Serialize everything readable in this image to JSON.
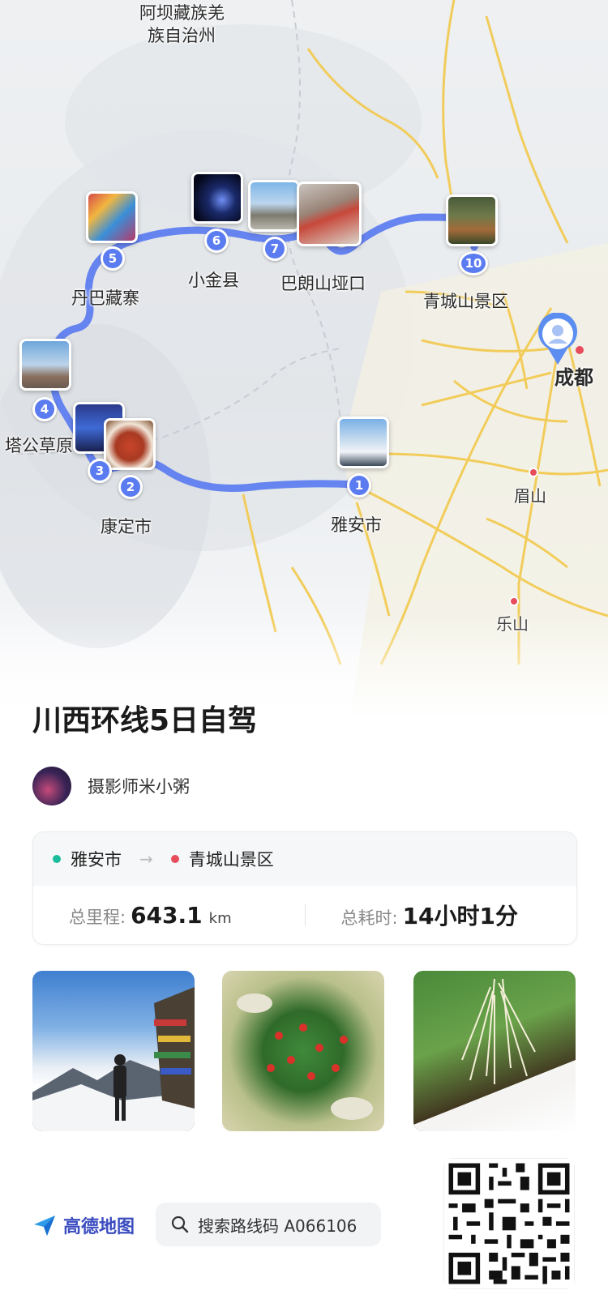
{
  "map": {
    "regions": {
      "aba": "阿坝藏族羌族自治州"
    },
    "places": {
      "aba_line1": "阿坝藏族羌",
      "aba_line2": "族自治州",
      "danba": "丹巴藏寨",
      "xiaojin": "小金县",
      "balang": "巴朗山垭口",
      "qingcheng": "青城山景区",
      "chengdu": "成都",
      "tagong": "塔公草原",
      "kangding": "康定市",
      "yaan": "雅安市",
      "meishan": "眉山",
      "leshan": "乐山"
    },
    "stops": [
      "1",
      "2",
      "3",
      "4",
      "5",
      "6",
      "7",
      "10"
    ],
    "route_color": "#5b7cf0"
  },
  "trip": {
    "title": "川西环线5日自驾",
    "author": "摄影师米小粥",
    "start": "雅安市",
    "end": "青城山景区",
    "start_color": "#1abc9c",
    "end_color": "#e74c5c",
    "distance_label": "总里程:",
    "distance_value": "643.1",
    "distance_unit": "km",
    "time_label": "总耗时:",
    "time_value": "14小时1分"
  },
  "footer": {
    "brand": "高德地图",
    "search_text": "搜索路线码 A066106"
  }
}
